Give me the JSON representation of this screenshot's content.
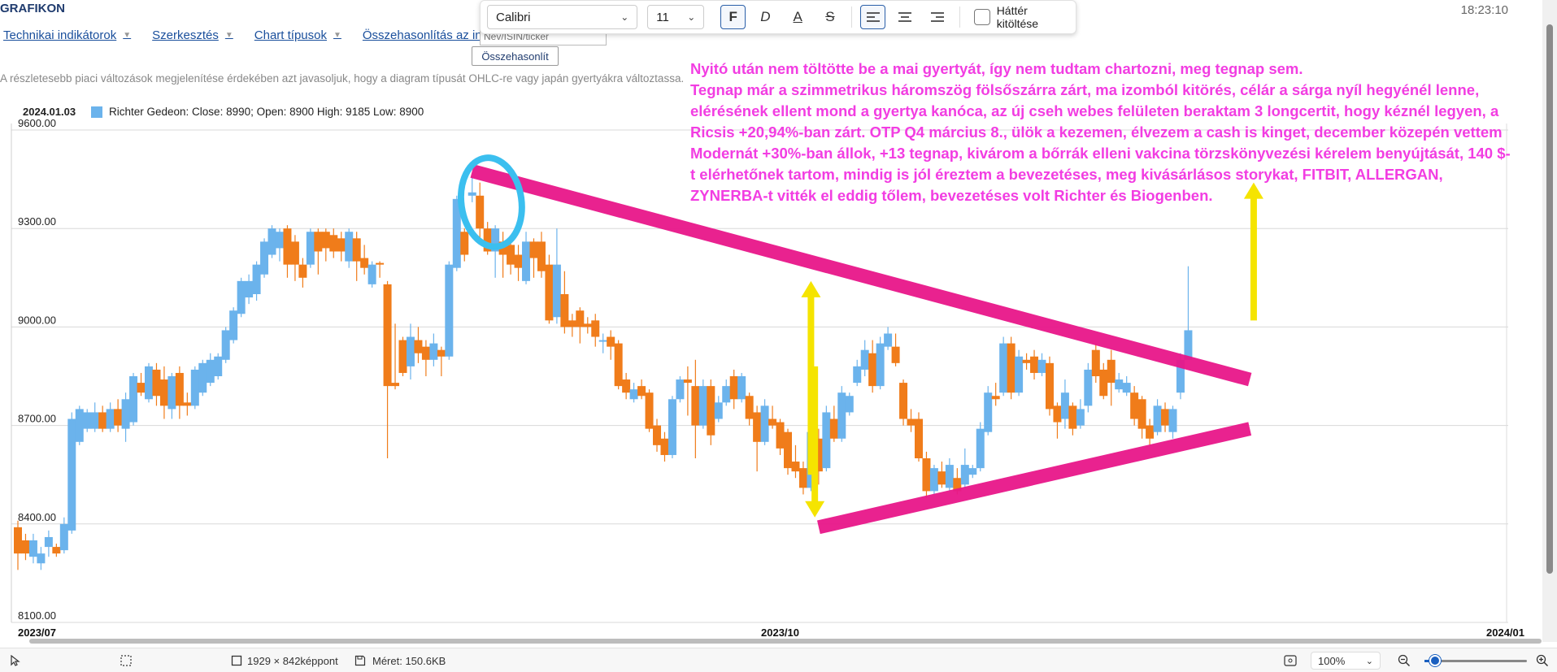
{
  "app": {
    "title": "GRAFIKON",
    "clock": "18:23:10"
  },
  "menu": {
    "items": [
      {
        "label": "Technikai indikátorok"
      },
      {
        "label": "Szerkesztés"
      },
      {
        "label": "Chart típusok"
      },
      {
        "label": "Összehasonlítás az indexszel"
      }
    ]
  },
  "search": {
    "placeholder": "Név/ISIN/ticker"
  },
  "compare_button": "Összehasonlít",
  "hint": "A részletesebb piaci változások megjelenítése érdekében azt javasoljuk, hogy a diagram típusát OHLC-re vagy japán gyertyákra változtassa.",
  "format_toolbar": {
    "font": "Calibri",
    "size": "11",
    "bold_label": "F",
    "italic_label": "D",
    "color_label": "A",
    "strike_label": "S",
    "fill_label": "Háttér kitöltése"
  },
  "legend": {
    "date": "2024.01.03",
    "text": "Richter Gedeon: Close: 8990; Open: 8900 High: 9185 Low: 8900"
  },
  "annotation": [
    "Nyitó után nem töltötte be a mai gyertyát, így nem tudtam chartozni, meg tegnap sem.",
    "Tegnap már a szimmetrikus háromszög fölsőszárra zárt, ma izomból kitörés, célár a sárga nyíl hegyénél lenne, elérésének ellent mond a gyertya kanóca, az új cseh webes felületen beraktam 3 longcertit, hogy kéznél legyen, a Ricsis +20,94%-ban zárt. OTP Q4 március 8., ülök a kezemen, élvezem a cash is kinget, december közepén vettem Modernát +30%-ban állok, +13 tegnap, kivárom a bőrrák elleni vakcina törzskönyvezési kérelem benyújtását, 140 $-t elérhetőnek tartom, mindig is jól éreztem a bevezetéses, meg kivásárlásos storykat, FITBIT, ALLERGAN, ZYNERBA-t vitték el eddig tőlem, bevezetéses volt Richter és Biogenben."
  ],
  "statusbar": {
    "dimensions": "1929 × 842képpont",
    "size": "Méret: 150.6KB",
    "zoom": "100%",
    "zoom_level": 0.1
  },
  "colors": {
    "up": "#6bb3ec",
    "down": "#f07c1a",
    "trendline": "#e8178a",
    "arrow": "#f5e400",
    "circle": "#3bbfef",
    "annotation": "#f23de2"
  },
  "chart_data": {
    "type": "candlestick",
    "ylim": [
      8100,
      9600
    ],
    "yticks": [
      "9600.00",
      "9300.00",
      "9000.00",
      "8700.00",
      "8400.00",
      "8100.00"
    ],
    "xticks": [
      "2023/07",
      "2023/10",
      "2024/01"
    ],
    "grid": true,
    "candles": [
      {
        "o": 8390,
        "c": 8310,
        "h": 8410,
        "l": 8260
      },
      {
        "o": 8350,
        "c": 8310,
        "h": 8370,
        "l": 8290
      },
      {
        "o": 8300,
        "c": 8350,
        "h": 8370,
        "l": 8280
      },
      {
        "o": 8280,
        "c": 8310,
        "h": 8330,
        "l": 8260
      },
      {
        "o": 8330,
        "c": 8360,
        "h": 8380,
        "l": 8300
      },
      {
        "o": 8330,
        "c": 8310,
        "h": 8340,
        "l": 8300
      },
      {
        "o": 8320,
        "c": 8400,
        "h": 8420,
        "l": 8310
      },
      {
        "o": 8380,
        "c": 8720,
        "h": 8740,
        "l": 8370
      },
      {
        "o": 8650,
        "c": 8750,
        "h": 8760,
        "l": 8640
      },
      {
        "o": 8690,
        "c": 8740,
        "h": 8750,
        "l": 8680
      },
      {
        "o": 8690,
        "c": 8740,
        "h": 8770,
        "l": 8680
      },
      {
        "o": 8740,
        "c": 8690,
        "h": 8760,
        "l": 8680
      },
      {
        "o": 8690,
        "c": 8750,
        "h": 8770,
        "l": 8680
      },
      {
        "o": 8750,
        "c": 8700,
        "h": 8780,
        "l": 8680
      },
      {
        "o": 8690,
        "c": 8780,
        "h": 8800,
        "l": 8650
      },
      {
        "o": 8710,
        "c": 8850,
        "h": 8860,
        "l": 8700
      },
      {
        "o": 8830,
        "c": 8800,
        "h": 8860,
        "l": 8790
      },
      {
        "o": 8780,
        "c": 8880,
        "h": 8890,
        "l": 8770
      },
      {
        "o": 8870,
        "c": 8790,
        "h": 8890,
        "l": 8760
      },
      {
        "o": 8840,
        "c": 8760,
        "h": 8880,
        "l": 8720
      },
      {
        "o": 8750,
        "c": 8850,
        "h": 8860,
        "l": 8720
      },
      {
        "o": 8860,
        "c": 8760,
        "h": 8880,
        "l": 8720
      },
      {
        "o": 8770,
        "c": 8760,
        "h": 8800,
        "l": 8730
      },
      {
        "o": 8760,
        "c": 8870,
        "h": 8880,
        "l": 8750
      },
      {
        "o": 8800,
        "c": 8890,
        "h": 8900,
        "l": 8790
      },
      {
        "o": 8830,
        "c": 8900,
        "h": 8920,
        "l": 8820
      },
      {
        "o": 8850,
        "c": 8910,
        "h": 8920,
        "l": 8840
      },
      {
        "o": 8900,
        "c": 8990,
        "h": 9000,
        "l": 8890
      },
      {
        "o": 8960,
        "c": 9050,
        "h": 9060,
        "l": 8950
      },
      {
        "o": 9040,
        "c": 9140,
        "h": 9150,
        "l": 9030
      },
      {
        "o": 9090,
        "c": 9140,
        "h": 9160,
        "l": 9070
      },
      {
        "o": 9100,
        "c": 9190,
        "h": 9200,
        "l": 9080
      },
      {
        "o": 9160,
        "c": 9260,
        "h": 9270,
        "l": 9150
      },
      {
        "o": 9220,
        "c": 9300,
        "h": 9310,
        "l": 9210
      },
      {
        "o": 9240,
        "c": 9290,
        "h": 9300,
        "l": 9200
      },
      {
        "o": 9300,
        "c": 9190,
        "h": 9310,
        "l": 9150
      },
      {
        "o": 9260,
        "c": 9190,
        "h": 9280,
        "l": 9140
      },
      {
        "o": 9190,
        "c": 9150,
        "h": 9210,
        "l": 9120
      },
      {
        "o": 9190,
        "c": 9290,
        "h": 9300,
        "l": 9180
      },
      {
        "o": 9290,
        "c": 9230,
        "h": 9300,
        "l": 9160
      },
      {
        "o": 9290,
        "c": 9240,
        "h": 9300,
        "l": 9200
      },
      {
        "o": 9280,
        "c": 9230,
        "h": 9300,
        "l": 9210
      },
      {
        "o": 9270,
        "c": 9230,
        "h": 9290,
        "l": 9200
      },
      {
        "o": 9200,
        "c": 9290,
        "h": 9300,
        "l": 9180
      },
      {
        "o": 9270,
        "c": 9200,
        "h": 9290,
        "l": 9140
      },
      {
        "o": 9210,
        "c": 9180,
        "h": 9250,
        "l": 9160
      },
      {
        "o": 9130,
        "c": 9190,
        "h": 9200,
        "l": 9120
      },
      {
        "o": 9195,
        "c": 9190,
        "h": 9200,
        "l": 9150
      },
      {
        "o": 9130,
        "c": 8820,
        "h": 9140,
        "l": 8600
      },
      {
        "o": 8830,
        "c": 8820,
        "h": 9010,
        "l": 8810
      },
      {
        "o": 8960,
        "c": 8860,
        "h": 8970,
        "l": 8850
      },
      {
        "o": 8880,
        "c": 8970,
        "h": 9010,
        "l": 8840
      },
      {
        "o": 8960,
        "c": 8920,
        "h": 9000,
        "l": 8890
      },
      {
        "o": 8940,
        "c": 8900,
        "h": 8960,
        "l": 8850
      },
      {
        "o": 8900,
        "c": 8950,
        "h": 8980,
        "l": 8880
      },
      {
        "o": 8930,
        "c": 8910,
        "h": 8940,
        "l": 8850
      },
      {
        "o": 8910,
        "c": 9190,
        "h": 9200,
        "l": 8900
      },
      {
        "o": 9180,
        "c": 9390,
        "h": 9400,
        "l": 9170
      },
      {
        "o": 9290,
        "c": 9220,
        "h": 9300,
        "l": 9200
      },
      {
        "o": 9400,
        "c": 9410,
        "h": 9460,
        "l": 9380
      },
      {
        "o": 9400,
        "c": 9300,
        "h": 9440,
        "l": 9250
      },
      {
        "o": 9300,
        "c": 9230,
        "h": 9320,
        "l": 9220
      },
      {
        "o": 9230,
        "c": 9300,
        "h": 9310,
        "l": 9150
      },
      {
        "o": 9260,
        "c": 9220,
        "h": 9290,
        "l": 9150
      },
      {
        "o": 9250,
        "c": 9190,
        "h": 9280,
        "l": 9160
      },
      {
        "o": 9220,
        "c": 9180,
        "h": 9250,
        "l": 9140
      },
      {
        "o": 9140,
        "c": 9260,
        "h": 9290,
        "l": 9130
      },
      {
        "o": 9260,
        "c": 9210,
        "h": 9270,
        "l": 9150
      },
      {
        "o": 9260,
        "c": 9170,
        "h": 9290,
        "l": 9150
      },
      {
        "o": 9190,
        "c": 9020,
        "h": 9220,
        "l": 9010
      },
      {
        "o": 9030,
        "c": 9190,
        "h": 9300,
        "l": 9010
      },
      {
        "o": 9100,
        "c": 9000,
        "h": 9170,
        "l": 8980
      },
      {
        "o": 9020,
        "c": 9000,
        "h": 9040,
        "l": 8970
      },
      {
        "o": 9050,
        "c": 9000,
        "h": 9060,
        "l": 8950
      },
      {
        "o": 9010,
        "c": 9000,
        "h": 9030,
        "l": 8980
      },
      {
        "o": 9020,
        "c": 8970,
        "h": 9040,
        "l": 8940
      },
      {
        "o": 8960,
        "c": 8960,
        "h": 8980,
        "l": 8920
      },
      {
        "o": 8970,
        "c": 8940,
        "h": 8990,
        "l": 8900
      },
      {
        "o": 8950,
        "c": 8820,
        "h": 8960,
        "l": 8810
      },
      {
        "o": 8840,
        "c": 8800,
        "h": 8860,
        "l": 8780
      },
      {
        "o": 8780,
        "c": 8810,
        "h": 8830,
        "l": 8770
      },
      {
        "o": 8820,
        "c": 8790,
        "h": 8840,
        "l": 8780
      },
      {
        "o": 8800,
        "c": 8690,
        "h": 8810,
        "l": 8680
      },
      {
        "o": 8700,
        "c": 8640,
        "h": 8720,
        "l": 8620
      },
      {
        "o": 8660,
        "c": 8610,
        "h": 8680,
        "l": 8590
      },
      {
        "o": 8610,
        "c": 8780,
        "h": 8790,
        "l": 8600
      },
      {
        "o": 8780,
        "c": 8840,
        "h": 8850,
        "l": 8770
      },
      {
        "o": 8840,
        "c": 8830,
        "h": 8880,
        "l": 8730
      },
      {
        "o": 8820,
        "c": 8700,
        "h": 8900,
        "l": 8600
      },
      {
        "o": 8700,
        "c": 8820,
        "h": 8840,
        "l": 8690
      },
      {
        "o": 8820,
        "c": 8670,
        "h": 8840,
        "l": 8640
      },
      {
        "o": 8720,
        "c": 8770,
        "h": 8790,
        "l": 8710
      },
      {
        "o": 8770,
        "c": 8820,
        "h": 8840,
        "l": 8760
      },
      {
        "o": 8850,
        "c": 8780,
        "h": 8870,
        "l": 8750
      },
      {
        "o": 8780,
        "c": 8850,
        "h": 8860,
        "l": 8770
      },
      {
        "o": 8790,
        "c": 8720,
        "h": 8800,
        "l": 8700
      },
      {
        "o": 8740,
        "c": 8650,
        "h": 8760,
        "l": 8560
      },
      {
        "o": 8650,
        "c": 8760,
        "h": 8780,
        "l": 8640
      },
      {
        "o": 8720,
        "c": 8700,
        "h": 8760,
        "l": 8690
      },
      {
        "o": 8710,
        "c": 8630,
        "h": 8720,
        "l": 8610
      },
      {
        "o": 8680,
        "c": 8570,
        "h": 8690,
        "l": 8550
      },
      {
        "o": 8590,
        "c": 8560,
        "h": 8640,
        "l": 8540
      },
      {
        "o": 8570,
        "c": 8510,
        "h": 8590,
        "l": 8490
      },
      {
        "o": 8510,
        "c": 8680,
        "h": 8700,
        "l": 8500
      },
      {
        "o": 8660,
        "c": 8560,
        "h": 8690,
        "l": 8520
      },
      {
        "o": 8570,
        "c": 8740,
        "h": 8760,
        "l": 8560
      },
      {
        "o": 8720,
        "c": 8660,
        "h": 8760,
        "l": 8650
      },
      {
        "o": 8660,
        "c": 8800,
        "h": 8820,
        "l": 8650
      },
      {
        "o": 8740,
        "c": 8790,
        "h": 8800,
        "l": 8730
      },
      {
        "o": 8830,
        "c": 8880,
        "h": 8900,
        "l": 8820
      },
      {
        "o": 8870,
        "c": 8930,
        "h": 8960,
        "l": 8850
      },
      {
        "o": 8920,
        "c": 8820,
        "h": 8960,
        "l": 8800
      },
      {
        "o": 8820,
        "c": 8950,
        "h": 8970,
        "l": 8810
      },
      {
        "o": 8940,
        "c": 8980,
        "h": 9000,
        "l": 8930
      },
      {
        "o": 8940,
        "c": 8890,
        "h": 8980,
        "l": 8880
      },
      {
        "o": 8830,
        "c": 8720,
        "h": 8840,
        "l": 8700
      },
      {
        "o": 8720,
        "c": 8700,
        "h": 8750,
        "l": 8680
      },
      {
        "o": 8720,
        "c": 8600,
        "h": 8740,
        "l": 8590
      },
      {
        "o": 8600,
        "c": 8500,
        "h": 8620,
        "l": 8480
      },
      {
        "o": 8500,
        "c": 8570,
        "h": 8580,
        "l": 8490
      },
      {
        "o": 8560,
        "c": 8520,
        "h": 8590,
        "l": 8510
      },
      {
        "o": 8510,
        "c": 8580,
        "h": 8600,
        "l": 8500
      },
      {
        "o": 8540,
        "c": 8500,
        "h": 8570,
        "l": 8490
      },
      {
        "o": 8520,
        "c": 8580,
        "h": 8630,
        "l": 8510
      },
      {
        "o": 8550,
        "c": 8570,
        "h": 8580,
        "l": 8540
      },
      {
        "o": 8570,
        "c": 8690,
        "h": 8710,
        "l": 8560
      },
      {
        "o": 8680,
        "c": 8800,
        "h": 8820,
        "l": 8670
      },
      {
        "o": 8790,
        "c": 8780,
        "h": 8830,
        "l": 8760
      },
      {
        "o": 8800,
        "c": 8950,
        "h": 8970,
        "l": 8790
      },
      {
        "o": 8950,
        "c": 8800,
        "h": 8970,
        "l": 8780
      },
      {
        "o": 8800,
        "c": 8910,
        "h": 8930,
        "l": 8790
      },
      {
        "o": 8900,
        "c": 8890,
        "h": 8920,
        "l": 8870
      },
      {
        "o": 8910,
        "c": 8860,
        "h": 8930,
        "l": 8840
      },
      {
        "o": 8860,
        "c": 8900,
        "h": 8920,
        "l": 8850
      },
      {
        "o": 8890,
        "c": 8750,
        "h": 8910,
        "l": 8730
      },
      {
        "o": 8760,
        "c": 8710,
        "h": 8770,
        "l": 8660
      },
      {
        "o": 8720,
        "c": 8800,
        "h": 8840,
        "l": 8690
      },
      {
        "o": 8760,
        "c": 8690,
        "h": 8770,
        "l": 8670
      },
      {
        "o": 8700,
        "c": 8750,
        "h": 8780,
        "l": 8690
      },
      {
        "o": 8760,
        "c": 8870,
        "h": 8890,
        "l": 8740
      },
      {
        "o": 8930,
        "c": 8850,
        "h": 8950,
        "l": 8830
      },
      {
        "o": 8870,
        "c": 8790,
        "h": 8890,
        "l": 8780
      },
      {
        "o": 8900,
        "c": 8830,
        "h": 8930,
        "l": 8760
      },
      {
        "o": 8810,
        "c": 8840,
        "h": 8860,
        "l": 8800
      },
      {
        "o": 8800,
        "c": 8830,
        "h": 8850,
        "l": 8790
      },
      {
        "o": 8800,
        "c": 8720,
        "h": 8820,
        "l": 8700
      },
      {
        "o": 8780,
        "c": 8690,
        "h": 8790,
        "l": 8660
      },
      {
        "o": 8700,
        "c": 8660,
        "h": 8720,
        "l": 8640
      },
      {
        "o": 8680,
        "c": 8760,
        "h": 8780,
        "l": 8670
      },
      {
        "o": 8750,
        "c": 8700,
        "h": 8770,
        "l": 8680
      },
      {
        "o": 8680,
        "c": 8750,
        "h": 8760,
        "l": 8660
      },
      {
        "o": 8800,
        "c": 8900,
        "h": 8920,
        "l": 8780
      },
      {
        "o": 8900,
        "c": 8990,
        "h": 9185,
        "l": 8900
      }
    ],
    "annotations": {
      "upper_trendline": [
        [
          59,
          9475
        ],
        [
          160,
          8840
        ]
      ],
      "lower_trendline": [
        [
          104,
          8390
        ],
        [
          160,
          8690
        ]
      ],
      "arrows": [
        [
          103,
          8550,
          9140
        ],
        [
          103.5,
          8880,
          8420
        ],
        [
          160.5,
          9020,
          9440
        ]
      ],
      "circle": [
        61.5,
        9380
      ]
    }
  }
}
